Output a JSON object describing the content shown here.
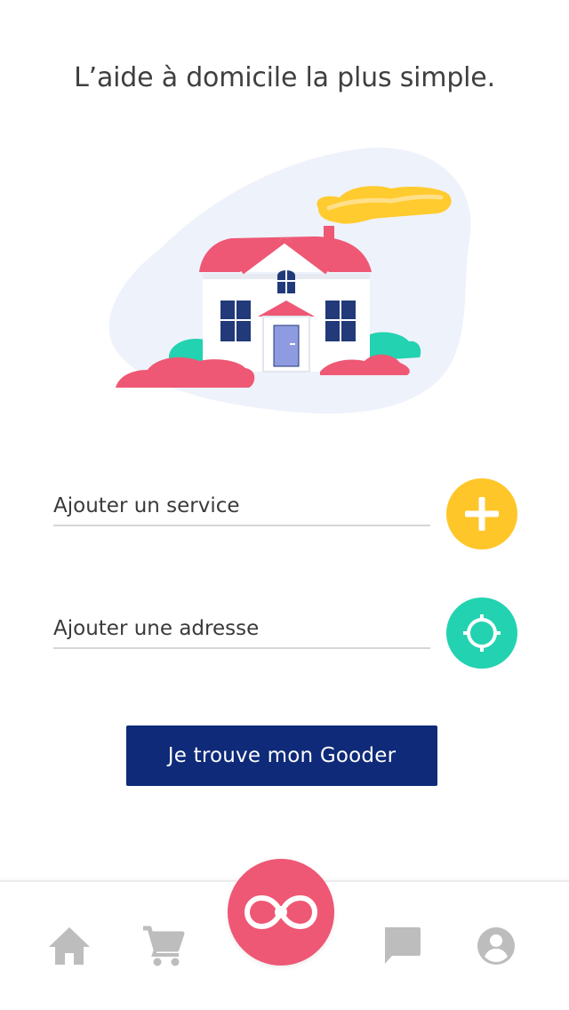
{
  "header": {
    "title": "L’aide à domicile la plus simple."
  },
  "form": {
    "service_placeholder": "Ajouter un service",
    "address_placeholder": "Ajouter une adresse",
    "submit_label": "Je trouve mon Gooder"
  },
  "icons": {
    "add": "plus-icon",
    "locate": "crosshair-icon",
    "home": "home-icon",
    "cart": "cart-icon",
    "messages": "chat-bubble-icon",
    "profile": "account-circle-icon",
    "center": "gooder-logo-icon"
  },
  "colors": {
    "primary": "#0e2a78",
    "add_button": "#ffc629",
    "locate_button": "#23d2b0",
    "center_button": "#ee5874",
    "nav_icon": "#bdbdbd"
  }
}
